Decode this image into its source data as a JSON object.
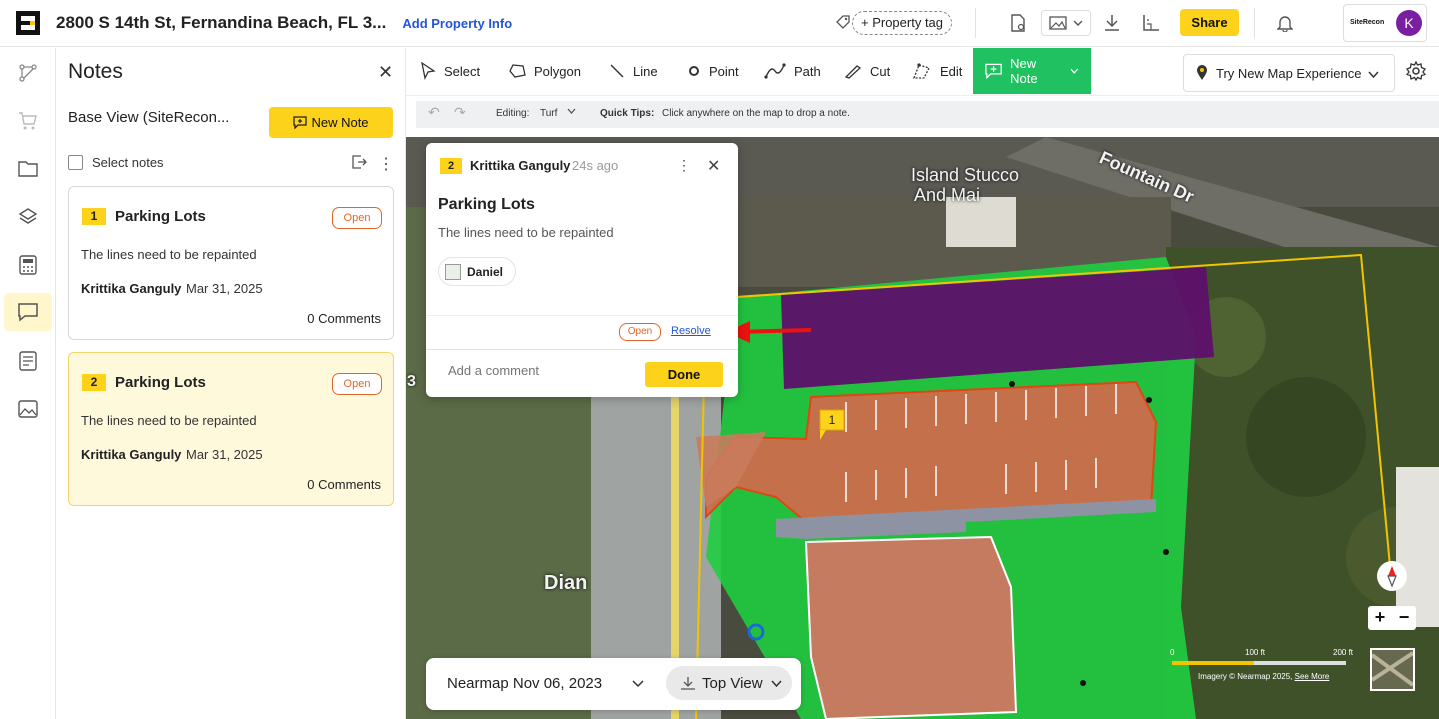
{
  "header": {
    "address": "2800 S 14th St, Fernandina Beach, FL 3...",
    "add_property_info": "Add Property Info",
    "property_tag": "+ Property tag",
    "share": "Share",
    "brand": "SiteRecon",
    "avatar_initial": "K"
  },
  "rail": {
    "items": [
      "route-icon",
      "cart-icon",
      "folder-icon",
      "layers-icon",
      "calculator-icon",
      "notes-icon",
      "document-icon",
      "image-icon"
    ]
  },
  "notes_panel": {
    "title": "Notes",
    "base_view": "Base View (SiteRecon...",
    "new_note": "New Note",
    "select_notes": "Select notes",
    "cards": [
      {
        "number": "1",
        "title": "Parking Lots",
        "status": "Open",
        "description": "The lines need to be repainted",
        "author": "Krittika Ganguly",
        "date": "Mar 31, 2025",
        "comments": "0 Comments"
      },
      {
        "number": "2",
        "title": "Parking Lots",
        "status": "Open",
        "description": "The lines need to be repainted",
        "author": "Krittika Ganguly",
        "date": "Mar 31, 2025",
        "comments": "0 Comments"
      }
    ]
  },
  "toolbar": {
    "tools": [
      "Select",
      "Polygon",
      "Line",
      "Point",
      "Path",
      "Cut",
      "Edit"
    ],
    "new_note": "New Note",
    "try_new": "Try New Map Experience"
  },
  "subbar": {
    "editing_label": "Editing:",
    "editing_value": "Turf",
    "quick_tips_label": "Quick Tips:",
    "quick_tips": "Click anywhere on the map to drop a note."
  },
  "popup": {
    "number": "2",
    "author": "Krittika Ganguly",
    "time": "24s ago",
    "title": "Parking Lots",
    "description": "The lines need to be repainted",
    "assignee": "Daniel",
    "status": "Open",
    "resolve": "Resolve",
    "comment_placeholder": "Add a comment",
    "done": "Done"
  },
  "map": {
    "label_island": "Island Stucco",
    "label_and": "And Mai",
    "label_fountain": "Fountain Dr",
    "label_dian": "Dian",
    "label_3": "3",
    "marker": "1",
    "scale_0": "0",
    "scale_100": "100 ft",
    "scale_200": "200 ft",
    "attribution": "Imagery © Nearmap 2025,",
    "see_more": "See More"
  },
  "datebar": {
    "date": "Nearmap Nov 06, 2023",
    "view": "Top View"
  },
  "colors": {
    "accent_yellow": "#fcd21b",
    "new_note_green": "#20c161",
    "status_orange": "#e26628",
    "link_blue": "#2455d8",
    "avatar_purple": "#7a1fa2"
  }
}
